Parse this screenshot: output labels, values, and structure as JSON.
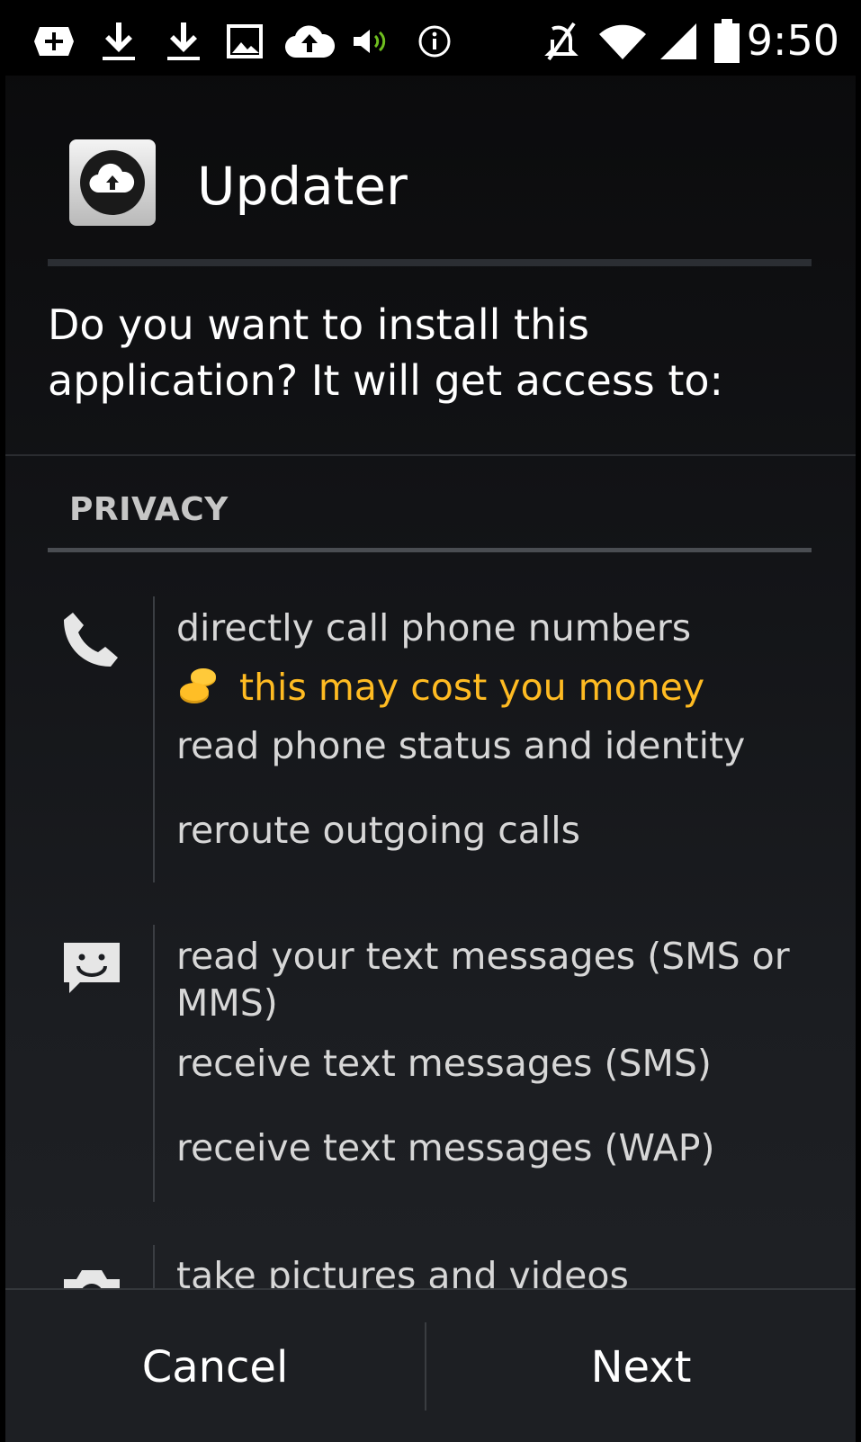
{
  "status_bar": {
    "time": "9:50",
    "left_icons": [
      "add-notification-icon",
      "download-icon",
      "download-icon",
      "image-icon",
      "cloud-upload-icon",
      "volume-icon",
      "info-icon"
    ],
    "right_icons": [
      "mute-icon",
      "wifi-icon",
      "signal-icon",
      "battery-icon"
    ]
  },
  "app": {
    "name": "Updater",
    "icon": "cloud-upload-app-icon"
  },
  "dialog": {
    "question": "Do you want to install this application? It will get access to:",
    "section_title": "PRIVACY"
  },
  "groups": [
    {
      "icon": "phone-icon",
      "permissions": [
        "directly call phone numbers",
        "read phone status and identity",
        "reroute outgoing calls"
      ],
      "cost_warning": "this may cost you money"
    },
    {
      "icon": "message-icon",
      "permissions": [
        "read your text messages (SMS or MMS)",
        "receive text messages (SMS)",
        "receive text messages (WAP)"
      ]
    },
    {
      "icon": "camera-icon",
      "permissions": [
        "take pictures and videos"
      ]
    }
  ],
  "buttons": {
    "cancel": "Cancel",
    "next": "Next"
  },
  "colors": {
    "warning": "#ffbb22",
    "background": "#141518"
  }
}
